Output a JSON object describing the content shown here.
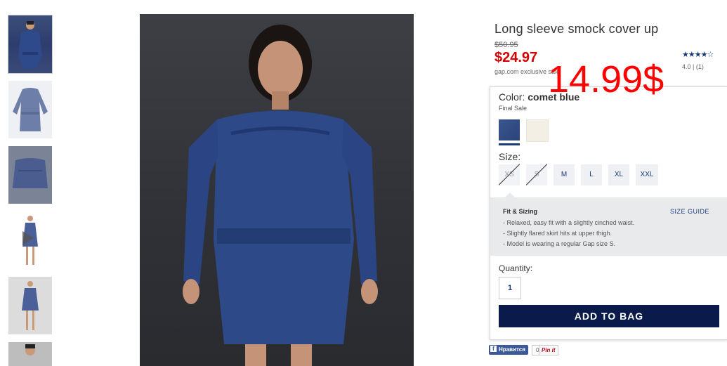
{
  "product": {
    "title": "Long sleeve smock cover up",
    "old_price": "$50.95",
    "price": "$24.97",
    "exclusive": "gap.com exclusive sale",
    "overlay_price": "14.99$",
    "stars": "★★★★☆",
    "rating": "4.0 | (1)"
  },
  "color": {
    "label": "Color:",
    "value": "comet blue",
    "final_sale": "Final Sale",
    "swatches": [
      "comet blue",
      "ivory"
    ],
    "colors": {
      "selected": "#2b4478",
      "alt": "#f3efe4"
    }
  },
  "size": {
    "label": "Size:",
    "options": [
      "XS",
      "S",
      "M",
      "L",
      "XL",
      "XXL"
    ],
    "unavailable": [
      "XS",
      "S"
    ]
  },
  "fit": {
    "title": "Fit & Sizing",
    "guide": "SIZE GUIDE",
    "lines": [
      "- Relaxed, easy fit with a slightly cinched waist.",
      "- Slightly flared skirt hits at upper thigh.",
      "- Model is wearing a regular Gap size S."
    ]
  },
  "quantity": {
    "label": "Quantity:",
    "value": "1"
  },
  "add_to_bag": "ADD TO BAG",
  "social": {
    "fb_label": "Нравится",
    "fb_count": "0",
    "pin_label": "Pin it"
  }
}
